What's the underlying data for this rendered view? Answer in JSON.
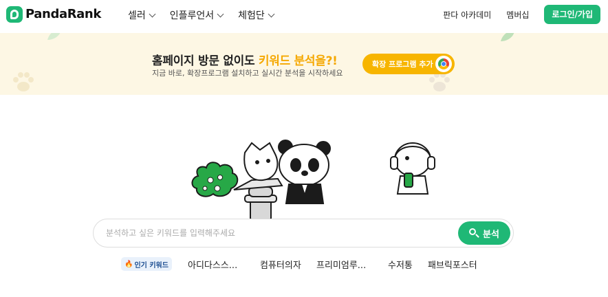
{
  "header": {
    "logo_text": "PandaRank",
    "nav": [
      {
        "label": "셀러"
      },
      {
        "label": "인플루언서"
      },
      {
        "label": "체험단"
      }
    ],
    "academy_label": "판다 아카데미",
    "membership_label": "멤버십",
    "login_label": "로그인/가입"
  },
  "banner": {
    "title_prefix": "홈페이지 방문 없이도 ",
    "title_highlight": "키워드 분석을?!",
    "subtitle": "지금 바로, 확장프로그램 설치하고 실시간 분석을 시작하세요",
    "extension_button_label": "확장 프로그램 추가",
    "icons": {
      "extension": "chrome-icon",
      "decor": [
        "paw-print-icon",
        "leaf-icon"
      ]
    }
  },
  "search": {
    "placeholder": "분석하고 싶은 키워드를 입력해주세요",
    "value": "",
    "button_label": "분석"
  },
  "popular": {
    "badge_label": "인기 키워드",
    "badge_icon": "fire-icon",
    "keywords": [
      "아디다스스...",
      "컴퓨터의자",
      "프리미엄루...",
      "수저통",
      "패브릭포스터"
    ]
  },
  "colors": {
    "brand_green": "#1fb876",
    "banner_bg": "#fdf7e4",
    "highlight_yellow": "#f5a800",
    "extension_button": "#f7b500"
  }
}
